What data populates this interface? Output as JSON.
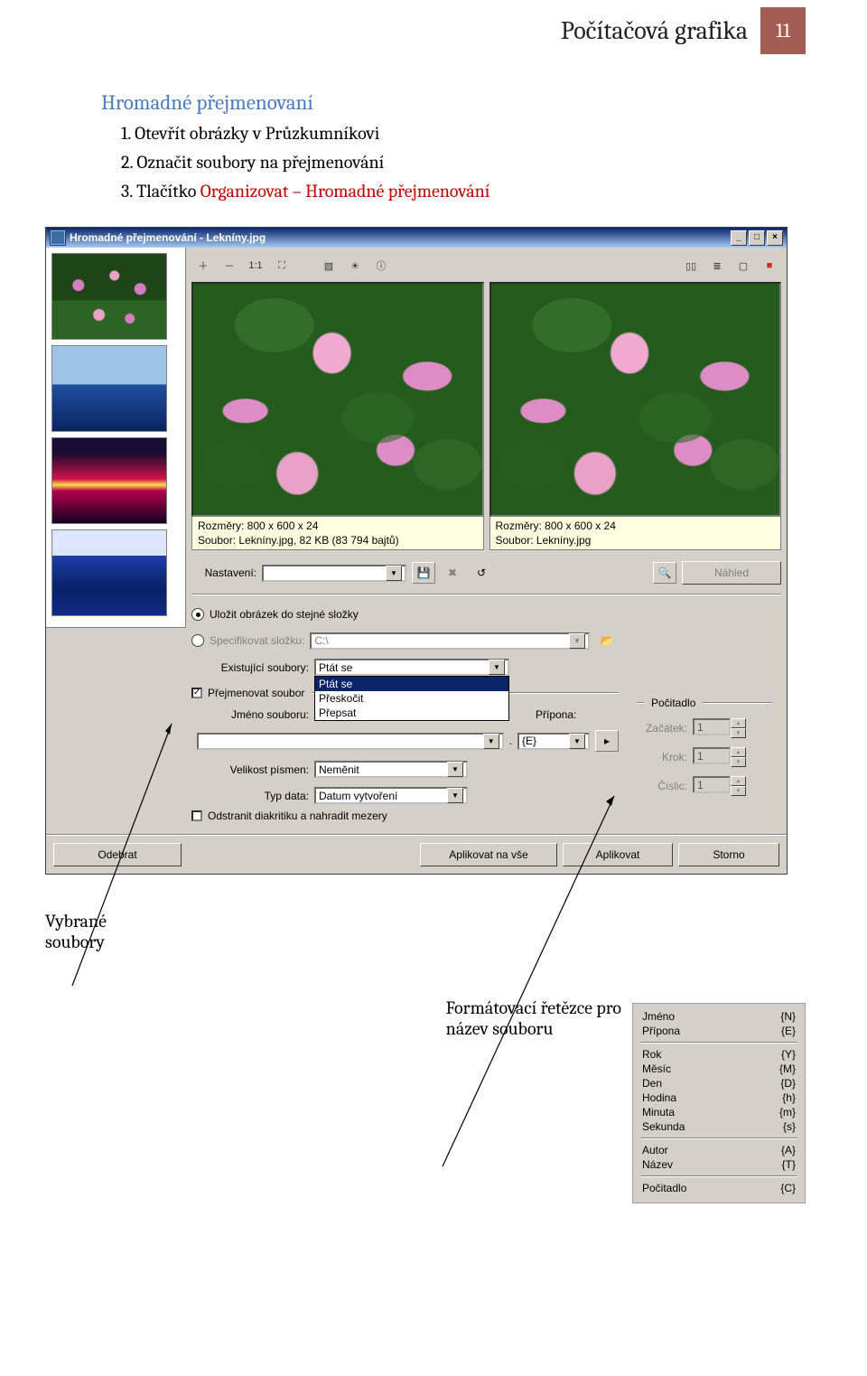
{
  "header": {
    "title": "Počítačová grafika",
    "page_num": "11"
  },
  "section": {
    "heading": "Hromadné přejmenovaní",
    "steps": {
      "n1": "1.",
      "s1": "Otevřít obrázky v Průzkumníkovi",
      "n2": "2.",
      "s2": "Označit soubory na přejmenování",
      "n3": "3.",
      "s3_a": "Tlačítko ",
      "s3_b": "Organizovat – Hromadné přejmenování"
    }
  },
  "win": {
    "title": "Hromadné přejmenování - Lekníny.jpg",
    "ctrl": {
      "min": "_",
      "max": "□",
      "close": "×",
      "chev": "▼",
      "dot3": "⋯",
      "play": "▸",
      "up": "▲",
      "dn": "▼"
    },
    "toolsL": [
      "＋",
      "－",
      "1:1",
      "⛶"
    ],
    "toolsM": [
      "▧",
      "☀",
      "ⓘ"
    ],
    "toolsR": [
      "▯▯",
      "≣",
      "▢",
      "■"
    ],
    "info": {
      "rozmery": "Rozměry: 800 x 600 x 24",
      "soubor_left": "Soubor: Lekníny.jpg, 82 KB (83 794 bajtů)",
      "soubor_right": "Soubor: Lekníny.jpg"
    },
    "labels": {
      "nastaveni": "Nastavení:",
      "nahled": "Náhled",
      "ulozit": "Uložit obrázek do stejné složky",
      "spec": "Specifikovat složku:",
      "spec_val": "C:\\",
      "exist": "Existující soubory:",
      "exist_val": "Ptát se",
      "exist_opts": {
        "o0": "Ptát se",
        "o1": "Přeskočit",
        "o2": "Přepsat"
      },
      "prej": "Přejmenovat soubor",
      "jmeno": "Jméno souboru:",
      "pripona": "Přípona:",
      "pripona_val": "{E}",
      "velikost": "Velikost písmen:",
      "velikost_val": "Neměnit",
      "typdata": "Typ data:",
      "typdata_val": "Datum vytvoření",
      "odstranit": "Odstranit diakritiku a nahradit mezery",
      "pocitadlo": "Počitadlo",
      "zacatek": "Začátek:",
      "zac_val": "1",
      "krok": "Krok:",
      "krok_val": "1",
      "cislic": "Číslic:",
      "cis_val": "1",
      "dot": "."
    },
    "footer": {
      "odebrat": "Odebrat",
      "aplikovat_vse": "Aplikovat na vše",
      "aplikovat": "Aplikovat",
      "storno": "Storno"
    }
  },
  "callouts": {
    "vybrane": "Vybrané",
    "soubory": "soubory",
    "formatovaci1": "Formátovací řetězce pro",
    "formatovaci2": "název souboru"
  },
  "format_codes": {
    "r0": {
      "l": "Jméno",
      "c": "{N}"
    },
    "r1": {
      "l": "Přípona",
      "c": "{E}"
    },
    "r2": {
      "l": "Rok",
      "c": "{Y}"
    },
    "r3": {
      "l": "Měsíc",
      "c": "{M}"
    },
    "r4": {
      "l": "Den",
      "c": "{D}"
    },
    "r5": {
      "l": "Hodina",
      "c": "{h}"
    },
    "r6": {
      "l": "Minuta",
      "c": "{m}"
    },
    "r7": {
      "l": "Sekunda",
      "c": "{s}"
    },
    "r8": {
      "l": "Autor",
      "c": "{A}"
    },
    "r9": {
      "l": "Název",
      "c": "{T}"
    },
    "r10": {
      "l": "Počitadlo",
      "c": "{C}"
    }
  }
}
